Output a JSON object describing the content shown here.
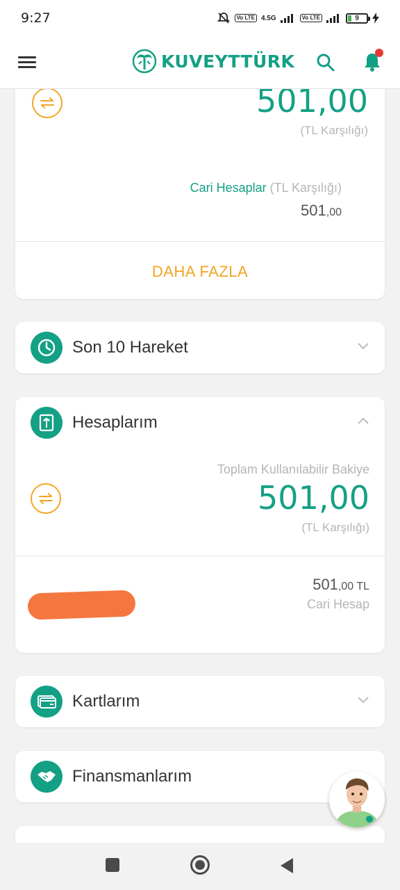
{
  "status_bar": {
    "time": "9:27",
    "network": "4.5G",
    "volte": "Vo LTE",
    "battery": "9"
  },
  "app_bar": {
    "brand": "KUVEYTTÜRK"
  },
  "summary_card": {
    "amount": "501,00",
    "amount_note": "(TL Karşılığı)",
    "cari_label": "Cari Hesaplar",
    "cari_note": "(TL Karşılığı)",
    "cari_amount_int": "501",
    "cari_amount_dec": ",00",
    "more_button": "DAHA FAZLA"
  },
  "sections": {
    "son10": "Son 10 Hareket",
    "hesaplarim": "Hesaplarım",
    "kartlarim": "Kartlarım",
    "finansmanlarim": "Finansmanlarım"
  },
  "accounts_card": {
    "total_label": "Toplam Kullanılabilir Bakiye",
    "amount": "501,00",
    "amount_note": "(TL Karşılığı)",
    "account_amount_int": "501",
    "account_amount_dec": ",00 TL",
    "account_type": "Cari Hesap"
  },
  "colors": {
    "brand_teal": "#14a085",
    "accent_orange": "#f2a623",
    "redaction": "#f4773f"
  }
}
